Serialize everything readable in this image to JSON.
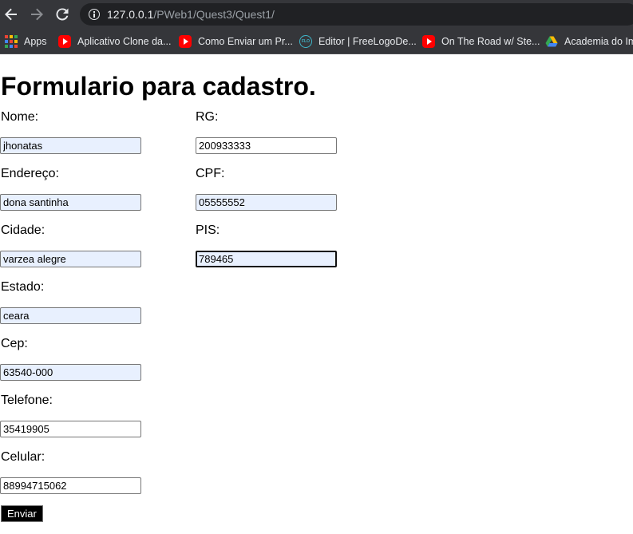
{
  "browser": {
    "url_host": "127.0.0.1",
    "url_path": "/PWeb1/Quest3/Quest1/",
    "bookmarks": [
      {
        "label": "Apps",
        "icon": "apps-grid-icon"
      },
      {
        "label": "Aplicativo Clone da...",
        "icon": "youtube-icon"
      },
      {
        "label": "Como Enviar um Pr...",
        "icon": "youtube-icon"
      },
      {
        "label": "Editor | FreeLogoDe...",
        "icon": "freelogo-icon"
      },
      {
        "label": "On The Road w/ Ste...",
        "icon": "youtube-icon"
      },
      {
        "label": "Academia do Im",
        "icon": "google-drive-icon"
      }
    ]
  },
  "form": {
    "title": "Formulario para cadastro.",
    "left_fields": [
      {
        "label": "Nome:",
        "value": "jhonatas",
        "autofilled": true
      },
      {
        "label": "Endereço:",
        "value": "dona santinha",
        "autofilled": true
      },
      {
        "label": "Cidade:",
        "value": "varzea alegre",
        "autofilled": true
      },
      {
        "label": "Estado:",
        "value": "ceara",
        "autofilled": true
      },
      {
        "label": "Cep:",
        "value": "63540-000",
        "autofilled": true
      },
      {
        "label": "Telefone:",
        "value": "35419905",
        "autofilled": false
      },
      {
        "label": "Celular:",
        "value": "88994715062",
        "autofilled": false
      }
    ],
    "right_fields": [
      {
        "label": "RG:",
        "value": "200933333",
        "autofilled": false
      },
      {
        "label": "CPF:",
        "value": "05555552",
        "autofilled": true
      },
      {
        "label": "PIS:",
        "value": "789465",
        "autofilled": true,
        "focused": true
      }
    ],
    "submit_label": "Enviar"
  }
}
